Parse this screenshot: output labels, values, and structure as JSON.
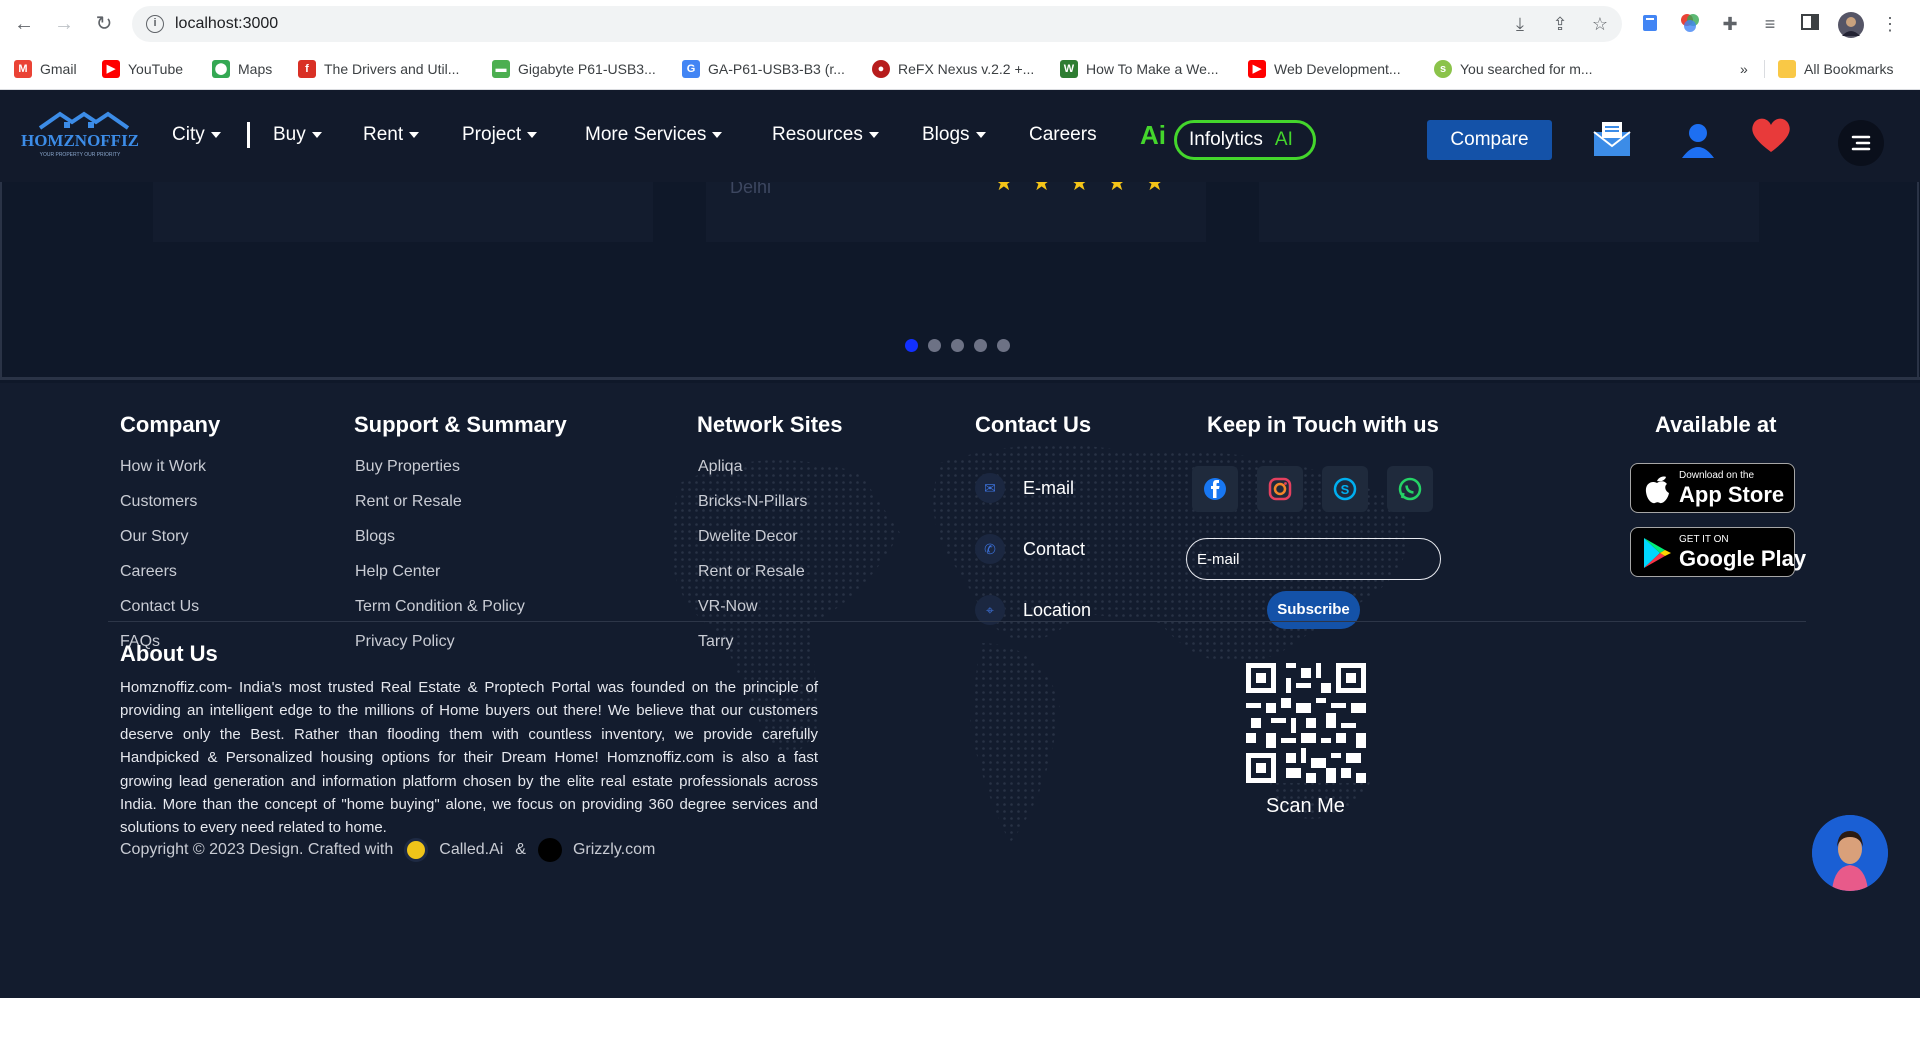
{
  "browser": {
    "url": "localhost:3000",
    "bookmarks": [
      {
        "label": "Gmail",
        "color": "#ea4335"
      },
      {
        "label": "YouTube",
        "color": "#ff0000"
      },
      {
        "label": "Maps",
        "color": "#34a853"
      },
      {
        "label": "The Drivers and Util...",
        "color": "#d93025"
      },
      {
        "label": "Gigabyte P61-USB3...",
        "color": "#4caf50"
      },
      {
        "label": "GA-P61-USB3-B3 (r...",
        "color": "#4285f4"
      },
      {
        "label": "ReFX Nexus v.2.2 +...",
        "color": "#b71c1c"
      },
      {
        "label": "How To Make a We...",
        "color": "#2e7d32"
      },
      {
        "label": "Web Development...",
        "color": "#ff0000"
      },
      {
        "label": "You searched for m...",
        "color": "#8bc34a"
      }
    ],
    "more_bookmarks": "»",
    "all_bookmarks": "All Bookmarks"
  },
  "nav": {
    "logo_text": "HOMZNOFFIZ",
    "logo_tagline": "YOUR PROPERTY OUR PRIORITY",
    "menu": [
      "City",
      "Buy",
      "Rent",
      "Project",
      "More Services",
      "Resources",
      "Blogs",
      "Careers"
    ],
    "ai_mark": "Ai",
    "infolytics": "Infolytics",
    "infolytics_ai": "AI",
    "compare": "Compare"
  },
  "carousel": {
    "review_city": "Delhi",
    "stars": "★★★★★",
    "dots_total": 5,
    "active_dot": 0
  },
  "footer": {
    "company": {
      "heading": "Company",
      "links": [
        "How it Work",
        "Customers",
        "Our Story",
        "Careers",
        "Contact Us",
        "FAQs"
      ]
    },
    "support": {
      "heading": "Support & Summary",
      "links": [
        "Buy Properties",
        "Rent or Resale",
        "Blogs",
        "Help Center",
        "Term Condition & Policy",
        "Privacy Policy"
      ]
    },
    "network": {
      "heading": "Network Sites",
      "links": [
        "Apliqa",
        "Bricks-N-Pillars",
        "Dwelite Decor",
        "Rent or Resale",
        "VR-Now",
        "Tarry"
      ]
    },
    "contact": {
      "heading": "Contact Us",
      "items": [
        {
          "label": "E-mail",
          "icon": "mail-icon"
        },
        {
          "label": "Contact",
          "icon": "phone-icon"
        },
        {
          "label": "Location",
          "icon": "location-icon"
        }
      ]
    },
    "keep_in_touch": {
      "heading": "Keep in Touch with us",
      "socials": [
        "facebook-icon",
        "instagram-icon",
        "skype-icon",
        "whatsapp-icon"
      ],
      "email_placeholder": "E-mail",
      "subscribe": "Subscribe"
    },
    "available": {
      "heading": "Available at",
      "app_store_small": "Download on the",
      "app_store_big": "App Store",
      "play_small": "GET IT ON",
      "play_big": "Google Play"
    },
    "about": {
      "title": "About Us",
      "text": "Homznoffiz.com- India's most trusted Real Estate & Proptech Portal was founded on the principle of providing an intelligent edge to the millions of Home buyers out there! We believe that our customers deserve only the Best. Rather than flooding them with countless inventory, we provide carefully Handpicked & Personalized housing options for their Dream Home! Homznoffiz.com is also a fast growing lead generation and information platform chosen by the elite real estate professionals across India. More than the concept of \"home buying\" alone, we focus on providing 360 degree services and solutions to every need related to home."
    },
    "scan_me": "Scan Me",
    "copyright": {
      "prefix": "Copyright © 2023 Design. Crafted with",
      "brand1": "Called.Ai",
      "amp": "&",
      "brand2": "Grizzly.com"
    }
  }
}
